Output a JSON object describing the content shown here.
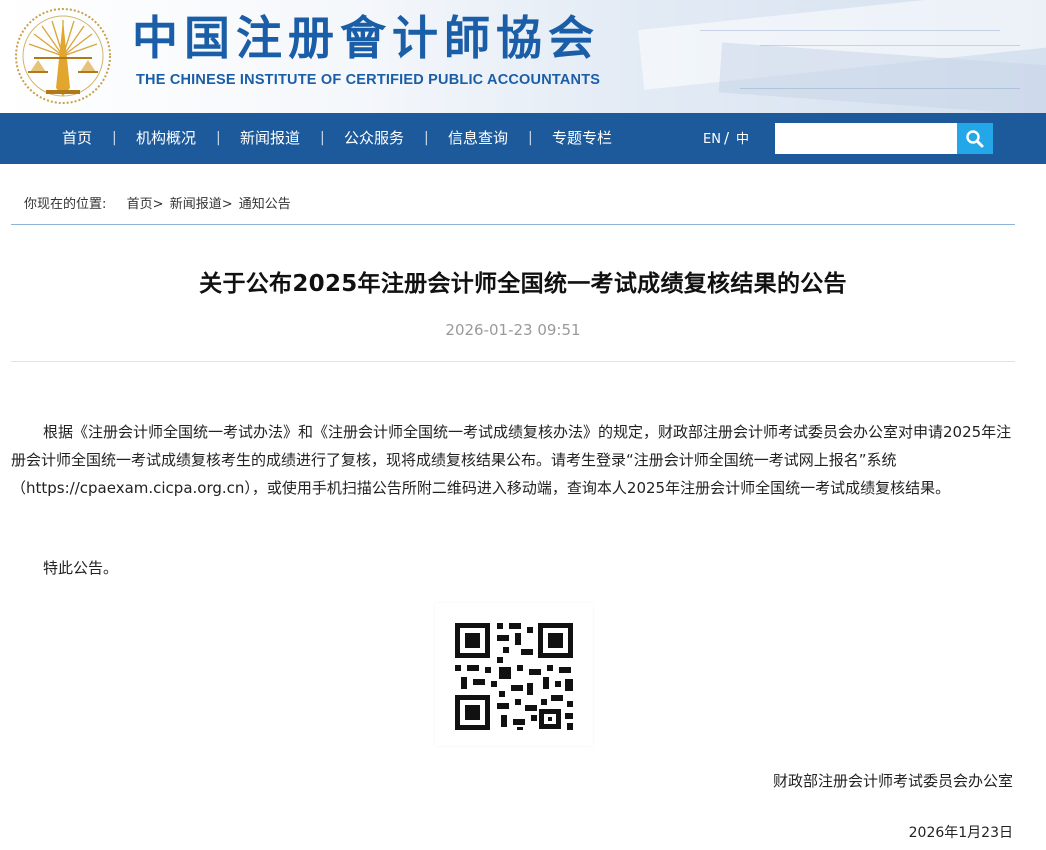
{
  "header": {
    "title_cn": "中国注册會计師協会",
    "title_en": "THE CHINESE INSTITUTE OF CERTIFIED PUBLIC ACCOUNTANTS",
    "logo_icon": "scales-emblem-icon",
    "brand_color": "#1b5ea8"
  },
  "nav": {
    "items": [
      {
        "label": "首页"
      },
      {
        "label": "机构概况"
      },
      {
        "label": "新闻报道"
      },
      {
        "label": "公众服务"
      },
      {
        "label": "信息查询"
      },
      {
        "label": "专题专栏"
      }
    ],
    "separator": "|",
    "lang_en": "EN",
    "lang_sep": "/",
    "lang_cn": "中",
    "search": {
      "value": "",
      "icon": "search-icon"
    },
    "bar_color": "#1d5a9c",
    "search_button_color": "#23a7e8"
  },
  "breadcrumb": {
    "prefix": "你现在的位置:",
    "items": [
      {
        "label": "首页>"
      },
      {
        "label": "新闻报道>"
      },
      {
        "label": "通知公告"
      }
    ]
  },
  "article": {
    "title": "关于公布2025年注册会计师全国统一考试成绩复核结果的公告",
    "date": "2026-01-23 09:51",
    "paragraph1": "根据《注册会计师全国统一考试办法》和《注册会计师全国统一考试成绩复核办法》的规定，财政部注册会计师考试委员会办公室对申请2025年注册会计师全国统一考试成绩复核考生的成绩进行了复核，现将成绩复核结果公布。请考生登录“注册会计师全国统一考试网上报名”系统（https://cpaexam.cicpa.org.cn），或使用手机扫描公告所附二维码进入移动端，查询本人2025年注册会计师全国统一考试成绩复核结果。",
    "paragraph2": "特此公告。",
    "qr_icon": "qr-code-icon",
    "signature": "财政部注册会计师考试委员会办公室",
    "sign_date": "2026年1月23日"
  }
}
